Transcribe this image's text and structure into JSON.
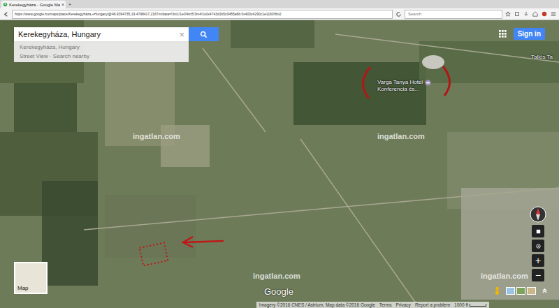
{
  "browser": {
    "tab_title": "Kerekegyháza - Google Ma",
    "tab_close": "×",
    "new_tab": "+",
    "url": "https://www.google.hu/maps/place/Kerekegyháza,+Hungary/@46.9394735,19.4798417,2167m/data=!3m1!1e3!4m5!3m4!1s0x4743d1b5c9455a6b:0x400c4290c1e1160!8m2",
    "search_placeholder": "Search"
  },
  "search": {
    "value": "Kerekegyháza, Hungary",
    "clear": "×"
  },
  "suggestions": [
    {
      "text": "Kerekegyháza, Hungary"
    },
    {
      "text": "Street View · Search nearby"
    }
  ],
  "account": {
    "sign_in": "Sign in"
  },
  "places": [
    {
      "label": "Varga Tanya Hotel",
      "sublabel": "Konferencia és..."
    },
    {
      "label": "Tallós Ta",
      "sublabel": ""
    }
  ],
  "watermarks": [
    "ingatlan.com",
    "ingatlan.com",
    "ingatlan.com",
    "ingatlan.com"
  ],
  "logo": "Google",
  "minimap": {
    "label": "Map"
  },
  "zoom": {
    "in": "+",
    "out": "−"
  },
  "footer": {
    "attribution": "Imagery ©2016 CNES / Astrium, Map data ©2016 Google",
    "links": [
      "Terms",
      "Privacy",
      "Report a problem"
    ],
    "scale": "1000 ft"
  }
}
